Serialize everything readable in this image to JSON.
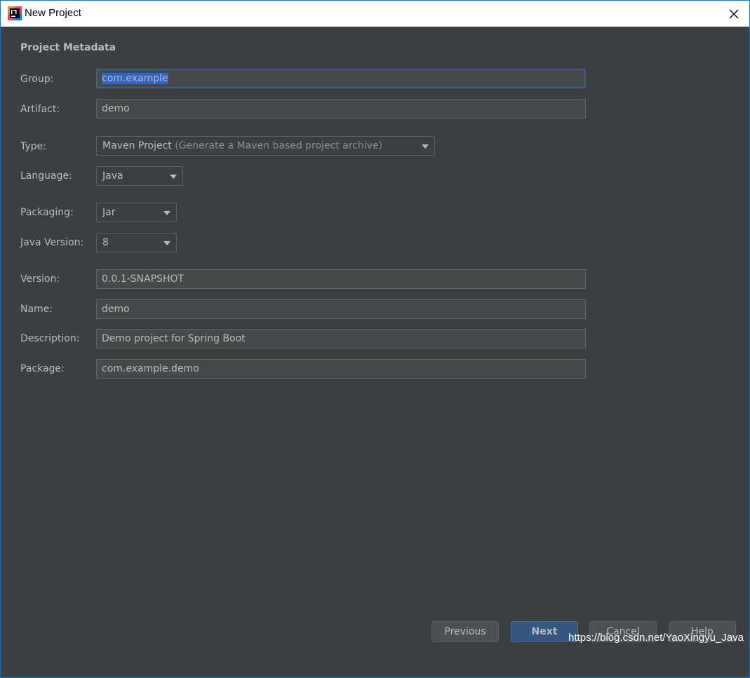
{
  "window": {
    "title": "New Project"
  },
  "section": {
    "title": "Project Metadata"
  },
  "form": {
    "group": {
      "label": "Group:",
      "value": "com.example"
    },
    "artifact": {
      "label": "Artifact:",
      "value": "demo"
    },
    "type": {
      "label": "Type:",
      "value": "Maven Project",
      "hint": "(Generate a Maven based project archive)"
    },
    "language": {
      "label": "Language:",
      "value": "Java"
    },
    "packaging": {
      "label": "Packaging:",
      "value": "Jar"
    },
    "java_version": {
      "label": "Java Version:",
      "value": "8"
    },
    "version": {
      "label": "Version:",
      "value": "0.0.1-SNAPSHOT"
    },
    "name": {
      "label": "Name:",
      "value": "demo"
    },
    "description": {
      "label": "Description:",
      "value": "Demo project for Spring Boot"
    },
    "package": {
      "label": "Package:",
      "value": "com.example.demo"
    }
  },
  "buttons": {
    "previous": "Previous",
    "next": "Next",
    "cancel": "Cancel",
    "help": "Help"
  },
  "watermark": "https://blog.csdn.net/YaoXingyu_Java",
  "colors": {
    "background": "#3c3f41",
    "field": "#45494a",
    "selection": "#2f65ca",
    "primary_button": "#365880",
    "text": "#bbbbbb"
  }
}
